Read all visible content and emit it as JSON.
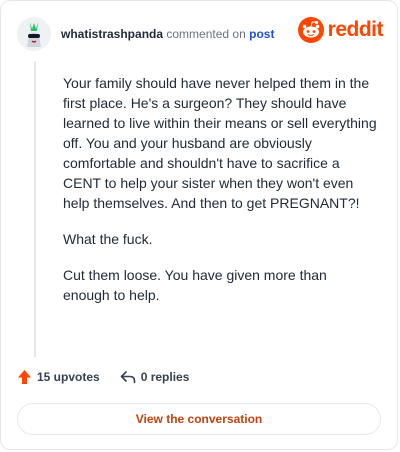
{
  "header": {
    "username": "whatistrashpanda",
    "action": "commented on",
    "post_link": "post",
    "brand": "reddit"
  },
  "comment": {
    "paragraphs": [
      "Your family should have never helped them in the first place. He's a surgeon? They should have learned to live within their means or sell everything off. You and your husband are obviously comfortable and shouldn't have to sacrifice a CENT to help your sister when they won't even help themselves. And then to get PREGNANT?!",
      "What the fuck.",
      "Cut them loose. You have given more than enough to help."
    ]
  },
  "footer": {
    "upvotes": "15 upvotes",
    "replies": "0 replies"
  },
  "cta": {
    "label": "View the conversation"
  },
  "colors": {
    "brand": "#ff4500",
    "upvote": "#ff4500",
    "cta_text": "#c2410c"
  },
  "icons": [
    "user-avatar",
    "reddit-logo-icon",
    "upvote-arrow-icon",
    "reply-icon"
  ]
}
